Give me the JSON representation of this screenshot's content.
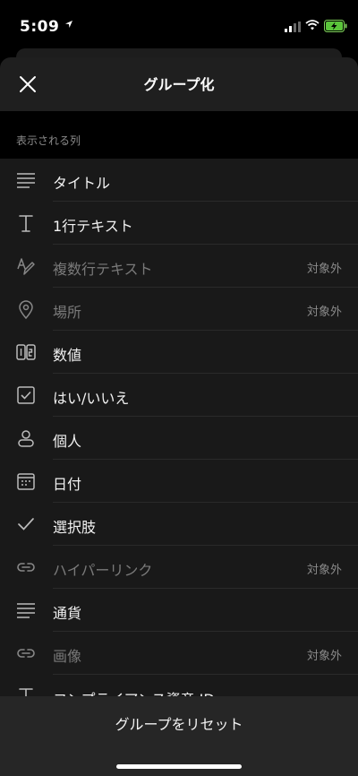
{
  "status_bar": {
    "time": "5:09"
  },
  "header": {
    "title": "グループ化"
  },
  "section_label": "表示される列",
  "columns": [
    {
      "label": "タイトル",
      "icon": "title-lines-icon",
      "badge": ""
    },
    {
      "label": "1行テキスト",
      "icon": "text-t-icon",
      "badge": ""
    },
    {
      "label": "複数行テキスト",
      "icon": "multiline-text-icon",
      "badge": "対象外"
    },
    {
      "label": "場所",
      "icon": "location-pin-icon",
      "badge": "対象外"
    },
    {
      "label": "数値",
      "icon": "number-icon",
      "badge": ""
    },
    {
      "label": "はい/いいえ",
      "icon": "checkbox-icon",
      "badge": ""
    },
    {
      "label": "個人",
      "icon": "person-icon",
      "badge": ""
    },
    {
      "label": "日付",
      "icon": "calendar-icon",
      "badge": ""
    },
    {
      "label": "選択肢",
      "icon": "checkmark-icon",
      "badge": ""
    },
    {
      "label": "ハイパーリンク",
      "icon": "link-icon",
      "badge": "対象外"
    },
    {
      "label": "通貨",
      "icon": "currency-lines-icon",
      "badge": ""
    },
    {
      "label": "画像",
      "icon": "image-link-icon",
      "badge": "対象外"
    },
    {
      "label": "コンプライアンス資産 ID",
      "icon": "text-t-icon",
      "badge": ""
    }
  ],
  "footer": {
    "reset_label": "グループをリセット"
  }
}
